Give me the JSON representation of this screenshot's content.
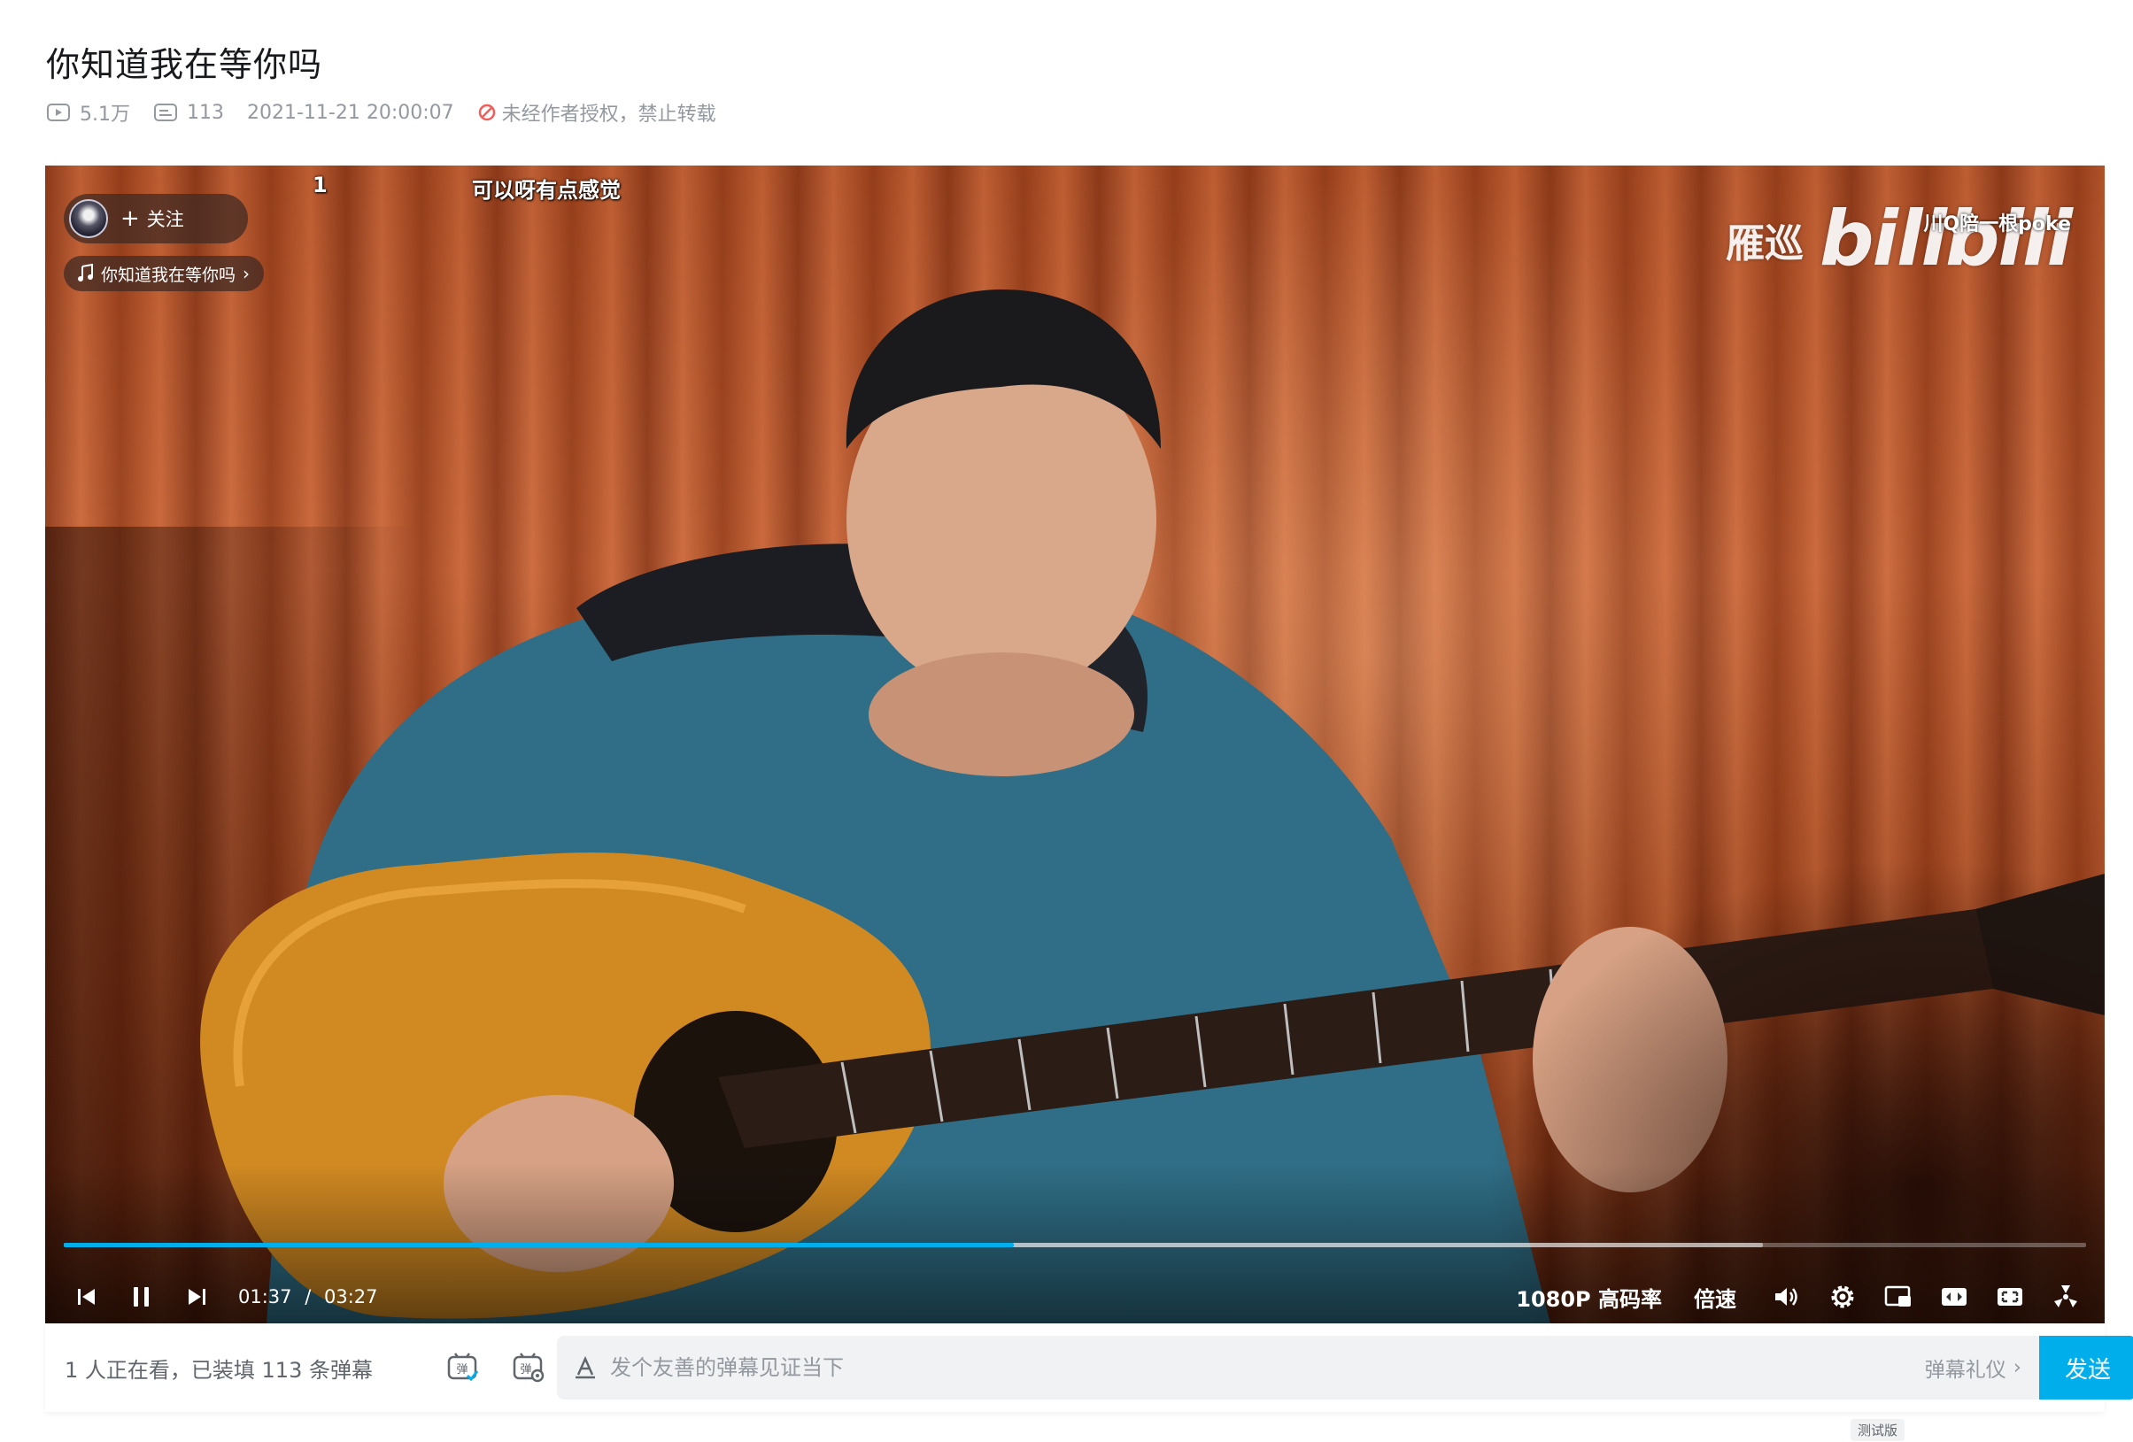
{
  "video": {
    "title": "你知道我在等你吗",
    "views": "5.1万",
    "danmaku_count": "113",
    "published": "2021-11-21 20:00:07",
    "copyright_notice": "未经作者授权，禁止转载"
  },
  "player": {
    "follow_label": "关注",
    "song_tag": "你知道我在等你吗",
    "danmaku": [
      {
        "text": "1"
      },
      {
        "text": "可以呀有点感觉"
      },
      {
        "text": "川Q陪一根poke"
      }
    ],
    "watermark_name": "雁巡",
    "watermark_logo": "bilibili",
    "current_time": "01:37",
    "time_separator": "/",
    "duration": "03:27",
    "progress_fraction": 0.47,
    "buffered_fraction": 0.84,
    "quality": "1080P 高码率",
    "speed": "倍速"
  },
  "sendbar": {
    "viewers_text": "1 人正在看，已装填 113 条弹幕",
    "input_placeholder": "发个友善的弹幕见证当下",
    "etiquette": "弹幕礼仪",
    "send_label": "发送",
    "beta": "测试版"
  },
  "colors": {
    "accent": "#00aeec",
    "forbid": "#f25d59"
  }
}
